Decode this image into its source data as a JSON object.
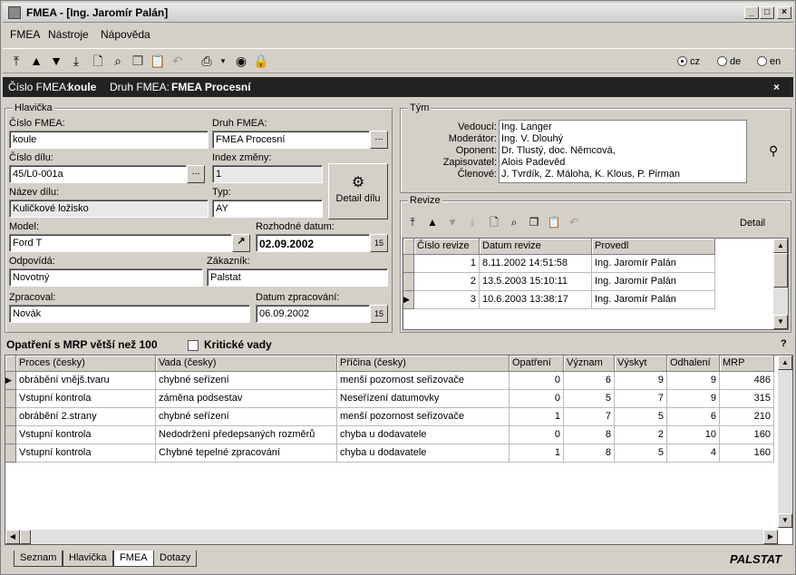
{
  "window": {
    "title": "FMEA - [Ing. Jaromír Palán]",
    "minimize": "_",
    "maximize": "□",
    "close": "×"
  },
  "menu": [
    "FMEA",
    "Nástroje",
    "Nápověda"
  ],
  "toolbar_icons": [
    "first-record-icon",
    "prev-record-icon",
    "next-record-icon",
    "last-record-icon",
    "new-document-icon",
    "binoculars-icon",
    "copy-icon",
    "paste-icon",
    "undo-icon",
    "print-icon",
    "dropdown-arrow-icon",
    "preview-icon",
    "lock-icon"
  ],
  "languages": [
    {
      "label": "cz",
      "selected": true
    },
    {
      "label": "de",
      "selected": false
    },
    {
      "label": "en",
      "selected": false
    }
  ],
  "infobar": {
    "cislo_label": "Číslo FMEA:",
    "cislo_value": "koule",
    "druh_label": "Druh FMEA:",
    "druh_value": "FMEA Procesní",
    "close": "×"
  },
  "hlavicka": {
    "legend": "Hlavička",
    "cislo_fmea": {
      "label": "Číslo FMEA:",
      "value": "koule"
    },
    "druh_fmea": {
      "label": "Druh FMEA:",
      "value": "FMEA Procesní"
    },
    "cislo_dilu": {
      "label": "Číslo dílu:",
      "value": "45/L0-001a"
    },
    "index_zmeny": {
      "label": "Index změny:",
      "value": "1"
    },
    "nazev_dilu": {
      "label": "Název dílu:",
      "value": "Kuličkové ložisko"
    },
    "typ": {
      "label": "Typ:",
      "value": "AY"
    },
    "detail_button": "Detail dílu",
    "model": {
      "label": "Model:",
      "value": "Ford T"
    },
    "rozhodne_datum": {
      "label": "Rozhodné datum:",
      "value": "02.09.2002"
    },
    "odpovida": {
      "label": "Odpovídá:",
      "value": "Novotný"
    },
    "zakaznik": {
      "label": "Zákazník:",
      "value": "Palstat"
    },
    "zpracoval": {
      "label": "Zpracoval:",
      "value": "Novák"
    },
    "datum_zpracovani": {
      "label": "Datum zpracování:",
      "value": "06.09.2002"
    },
    "ellipsis": "...",
    "calendar": "15"
  },
  "tym": {
    "legend": "Tým",
    "rows": [
      {
        "label": "Vedoucí:",
        "value": "Ing. Langer"
      },
      {
        "label": "Moderátor:",
        "value": "Ing. V. Dlouhý"
      },
      {
        "label": "Oponent:",
        "value": "Dr. Tlustý, doc. Němcová,"
      },
      {
        "label": "Zapisovatel:",
        "value": "Alois Padevěd"
      },
      {
        "label": "Členové:",
        "value": "J. Tvrdík, Z. Máloha, K. Klous, P. Pirman"
      }
    ]
  },
  "revize": {
    "legend": "Revize",
    "detail": "Detail",
    "headers": [
      "Číslo revize",
      "Datum revize",
      "Provedl"
    ],
    "rows": [
      {
        "cislo": "1",
        "datum": "8.11.2002 14:51:58",
        "provedl": "Ing. Jaromír Palán"
      },
      {
        "cislo": "2",
        "datum": "13.5.2003 15:10:11",
        "provedl": "Ing. Jaromír Palán"
      },
      {
        "cislo": "3",
        "datum": "10.6.2003 13:38:17",
        "provedl": "Ing. Jaromír Palán"
      }
    ]
  },
  "opatreni": {
    "title": "Opatření s MRP větší než 100",
    "checkbox_label": "Kritické vady",
    "help": "?",
    "headers": [
      "Proces (česky)",
      "Vada (česky)",
      "Příčina (česky)",
      "Opatření",
      "Význam",
      "Výskyt",
      "Odhalení",
      "MRP"
    ],
    "rows": [
      [
        "obrábění vnějš.tvaru",
        "chybné seřízení",
        "menší pozornost seřizovače",
        "0",
        "6",
        "9",
        "9",
        "486"
      ],
      [
        "Vstupní kontrola",
        "záměna podsestav",
        "Neseřízení datumovky",
        "0",
        "5",
        "7",
        "9",
        "315"
      ],
      [
        "obrábění 2.strany",
        "chybné seřízení",
        "menší pozornost seřizovače",
        "1",
        "7",
        "5",
        "6",
        "210"
      ],
      [
        "Vstupní kontrola",
        "Nedodržení předepsaných rozměrů",
        "chyba u dodavatele",
        "0",
        "8",
        "2",
        "10",
        "160"
      ],
      [
        "Vstupní kontrola",
        "Chybné tepelné zpracování",
        "chyba u dodavatele",
        "1",
        "8",
        "5",
        "4",
        "160"
      ]
    ]
  },
  "tabs": [
    {
      "label": "Seznam",
      "active": false
    },
    {
      "label": "Hlavička",
      "active": false
    },
    {
      "label": "FMEA",
      "active": true
    },
    {
      "label": "Dotazy",
      "active": false
    }
  ],
  "brand": "PALSTAT"
}
